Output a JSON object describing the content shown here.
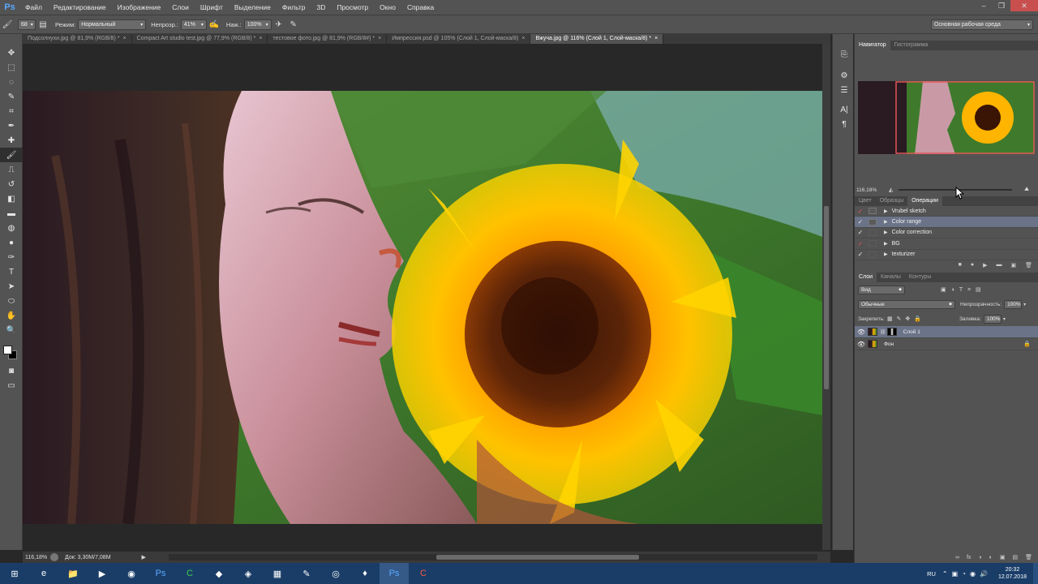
{
  "menubar": {
    "logo": "Ps",
    "items": [
      "Файл",
      "Редактирование",
      "Изображение",
      "Слои",
      "Шрифт",
      "Выделение",
      "Фильтр",
      "3D",
      "Просмотр",
      "Окно",
      "Справка"
    ],
    "window_controls": [
      "‒",
      "❐",
      "✕"
    ]
  },
  "options": {
    "brush_size": "68",
    "mode_label": "Режим:",
    "mode_value": "Нормальный",
    "opacity_label": "Непрозр.:",
    "opacity_value": "41%",
    "pressure_label": "Наж.:",
    "pressure_value": "100%",
    "workspace": "Основная рабочая среда"
  },
  "tabs": [
    {
      "label": "Подсолнухи.jpg @ 81,9% (RGB/8) *",
      "active": false
    },
    {
      "label": "Compact Art studio test.jpg @ 77,9% (RGB/8) *",
      "active": false
    },
    {
      "label": "тестовое фото.jpg @ 81,9% (RGB/8#) *",
      "active": false
    },
    {
      "label": "Импрессия.psd @ 105% (Слой 1, Слой-маска/8)",
      "active": false
    },
    {
      "label": "Вжуча.jpg @ 116% (Слой 1, Слой-маска/8) *",
      "active": true
    }
  ],
  "tools": [
    "move-tool",
    "marquee-tool",
    "lasso-tool",
    "quick-select-tool",
    "crop-tool",
    "eyedropper-tool",
    "healing-tool",
    "brush-tool",
    "stamp-tool",
    "history-brush-tool",
    "eraser-tool",
    "gradient-tool",
    "blur-tool",
    "dodge-tool",
    "pen-tool",
    "type-tool",
    "path-select-tool",
    "shape-tool",
    "hand-tool",
    "zoom-tool"
  ],
  "tool_glyphs": [
    "✥",
    "⬚",
    "◌",
    "✎",
    "⌗",
    "✒",
    "✚",
    "🖌",
    "⎍",
    "↺",
    "◧",
    "▬",
    "◍",
    "●",
    "✑",
    "T",
    "➤",
    "⬭",
    "✋",
    "🔍"
  ],
  "status": {
    "zoom": "116,18%",
    "doc_info": "Док: 3,30М/7,08М"
  },
  "navigator": {
    "tabs": [
      "Навигатор",
      "Гистограмма"
    ],
    "zoom": "116,18%"
  },
  "actions": {
    "tabs": [
      "Цвет",
      "Образцы",
      "Операции"
    ],
    "items": [
      {
        "name": "Vrubel sketch",
        "check": "red"
      },
      {
        "name": "Color range",
        "check": "white",
        "selected": true
      },
      {
        "name": "Color correction",
        "check": "white"
      },
      {
        "name": "BG",
        "check": "red"
      },
      {
        "name": "texturizer",
        "check": "white"
      }
    ],
    "footer_icons": [
      "■",
      "●",
      "▶",
      "▬",
      "▣",
      "🗑"
    ]
  },
  "layers": {
    "tabs": [
      "Слои",
      "Каналы",
      "Контуры"
    ],
    "filter": "Вид",
    "blend_mode": "Обычные",
    "opacity_label": "Непрозрачность:",
    "opacity_value": "100%",
    "lock_label": "Закрепить:",
    "fill_label": "Заливка:",
    "fill_value": "100%",
    "items": [
      {
        "name": "Слой 1",
        "selected": true,
        "has_mask": true
      },
      {
        "name": "Фон",
        "selected": false,
        "locked": true
      }
    ],
    "footer_icons": [
      "∞",
      "fx",
      "◑",
      "◐",
      "▣",
      "▤",
      "🗑"
    ]
  },
  "taskbar": {
    "apps": [
      "windows-start",
      "ie",
      "explorer",
      "media-player",
      "chrome",
      "photoshop",
      "corel",
      "app-8",
      "app-9",
      "app-10",
      "app-11",
      "app-12",
      "app-13",
      "photoshop-active",
      "app-15"
    ],
    "app_glyphs": [
      "⊞",
      "e",
      "📁",
      "▶",
      "◉",
      "Ps",
      "C",
      "◆",
      "◈",
      "▦",
      "✎",
      "◎",
      "♦",
      "Ps",
      "C"
    ],
    "language": "RU",
    "time": "20:32",
    "date": "12.07.2018"
  },
  "colors": {
    "ui_bg": "#535353",
    "dark_bg": "#282828",
    "accent_selected": "#6a7388",
    "taskbar": "#1a3d68",
    "close_red": "#c94f4f",
    "navigator_frame": "#e25555"
  }
}
